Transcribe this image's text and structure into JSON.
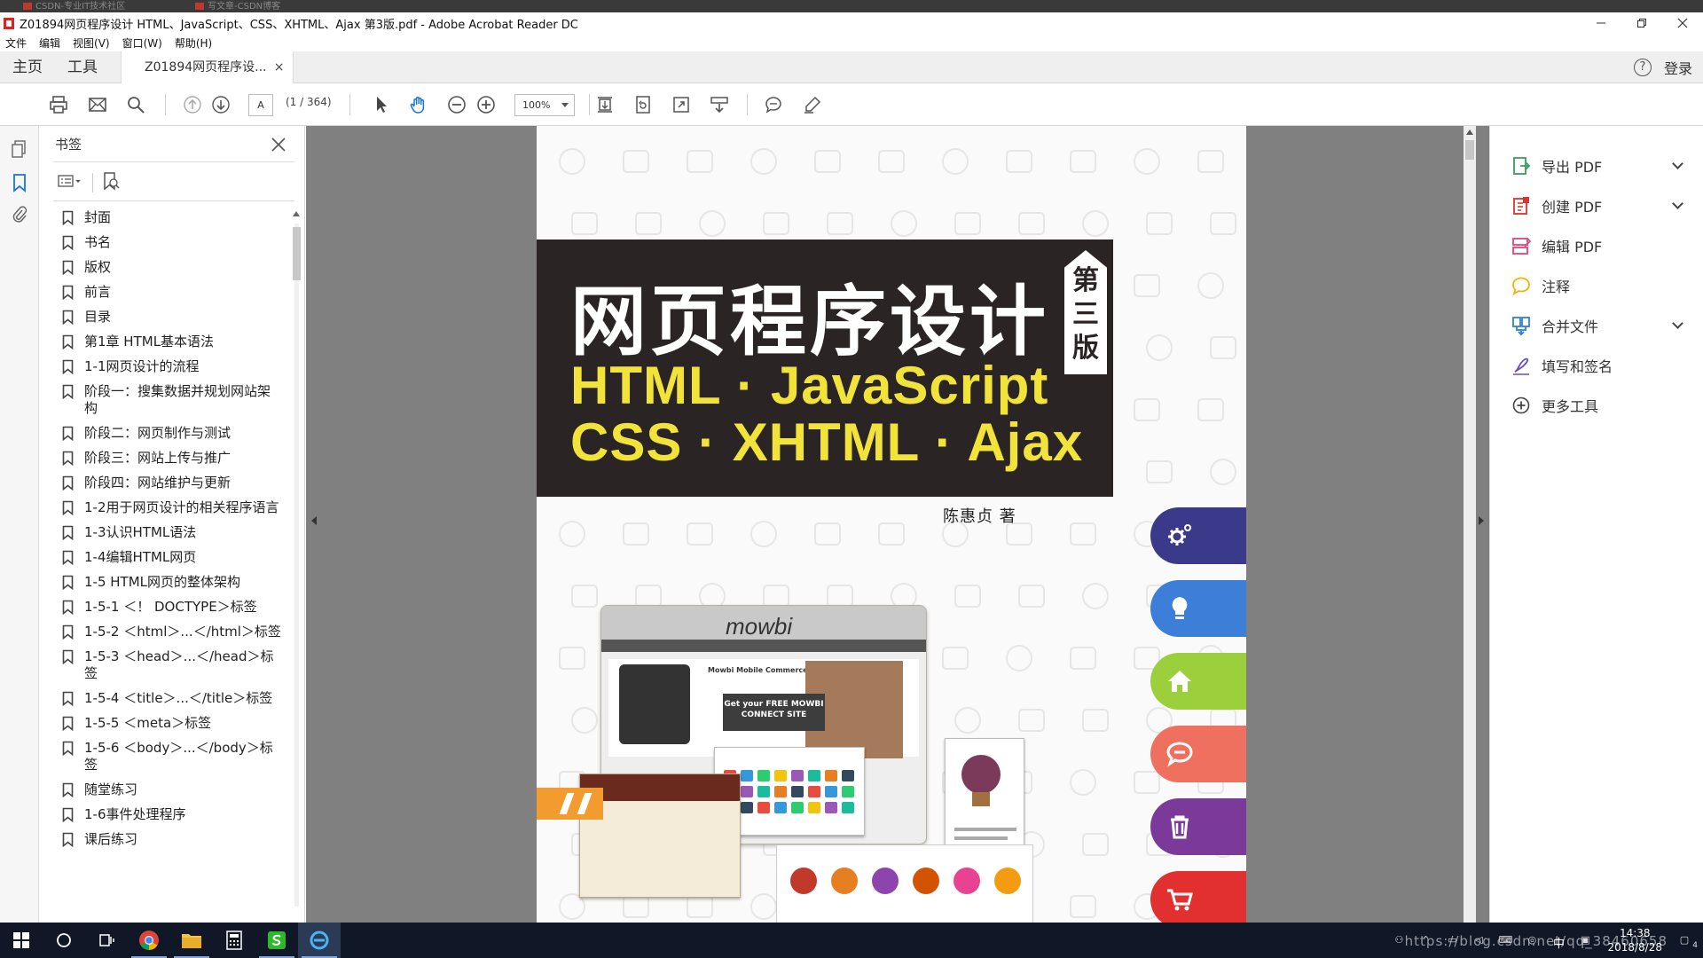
{
  "window": {
    "title": "Z01894网页程序设计 HTML、JavaScript、CSS、XHTML、Ajax 第3版.pdf - Adobe Acrobat Reader DC",
    "background_tabs": [
      "CSDN-专业IT技术社区",
      "写文章-CSDN博客"
    ]
  },
  "menu": [
    "文件",
    "编辑",
    "视图(V)",
    "窗口(W)",
    "帮助(H)"
  ],
  "tabs": {
    "home": "主页",
    "tools": "工具",
    "document": "Z01894网页程序设...",
    "close": "×",
    "help": "?",
    "login": "登录"
  },
  "toolbar": {
    "page_current": "A",
    "page_count": "(1 / 364)",
    "zoom": "100%"
  },
  "bookmarks": {
    "header": "书签",
    "items": [
      "封面",
      "书名",
      "版权",
      "前言",
      "目录",
      "第1章 HTML基本语法",
      "1-1网页设计的流程",
      "阶段一：搜集数据并规划网站架构",
      "阶段二：网页制作与测试",
      "阶段三：网站上传与推广",
      "阶段四：网站维护与更新",
      "1-2用于网页设计的相关程序语言",
      "1-3认识HTML语法",
      "1-4编辑HTML网页",
      "1-5 HTML网页的整体架构",
      "1-5-1 ＜！ DOCTYPE＞标签",
      "1-5-2 ＜html＞...＜/html＞标签",
      "1-5-3 ＜head＞...＜/head＞标签",
      "1-5-4 ＜title＞...＜/title＞标签",
      "1-5-5 ＜meta＞标签",
      "1-5-6 ＜body＞...＜/body＞标签",
      "随堂练习",
      "1-6事件处理程序",
      "课后练习"
    ]
  },
  "cover": {
    "cn_title": "网页程序设计",
    "en_line1": "HTML · JavaScript",
    "en_line2": "CSS · XHTML · Ajax",
    "edition": "第三版",
    "author": "陈惠贞 著",
    "site_logo": "mowbi",
    "site_headline": "Mowbi Mobile Commerce",
    "promo": "Get your FREE MOWBI CONNECT SITE",
    "pill_colors": [
      "#3b3a8a",
      "#3d7ed8",
      "#9bd03c",
      "#f07060",
      "#7b3a9a",
      "#e23030"
    ]
  },
  "tools_pane": [
    {
      "label": "导出 PDF",
      "icon": "export-pdf-icon",
      "color": "#3a9d5d",
      "expand": true
    },
    {
      "label": "创建 PDF",
      "icon": "create-pdf-icon",
      "color": "#d9342b",
      "expand": true
    },
    {
      "label": "编辑 PDF",
      "icon": "edit-pdf-icon",
      "color": "#e0457b",
      "expand": false
    },
    {
      "label": "注释",
      "icon": "comment-icon",
      "color": "#f0b400",
      "expand": false
    },
    {
      "label": "合并文件",
      "icon": "combine-files-icon",
      "color": "#2f7fd6",
      "expand": true
    },
    {
      "label": "填写和签名",
      "icon": "fill-sign-icon",
      "color": "#6a4bc4",
      "expand": false
    },
    {
      "label": "更多工具",
      "icon": "more-tools-icon",
      "color": "#444444",
      "expand": false
    }
  ],
  "taskbar": {
    "time": "14:38",
    "date": "2018/8/28",
    "ime": "中",
    "watermark": "https://blog.csdn.net/qq_38460658",
    "notif_count": "4"
  }
}
